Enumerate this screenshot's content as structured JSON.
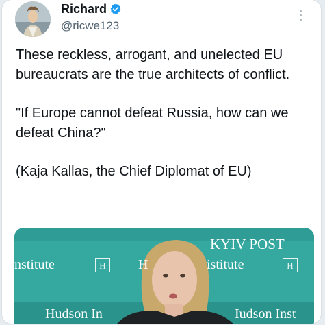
{
  "author": {
    "display_name": "Richard",
    "handle": "@ricwe123",
    "verified": true
  },
  "tweet": {
    "paragraphs": [
      "These reckless, arrogant, and unelected EU bureaucrats are the true architects of conflict.",
      "\"If Europe cannot defeat Russia, how can we defeat China?\"",
      "(Kaja Kallas, the Chief Diplomat of EU)"
    ]
  },
  "media": {
    "backdrop_texts": {
      "kyiv_post": "KYIV POST",
      "institute_left": "nstitute",
      "institute_right": "istitute",
      "hudson_left": "Hudson In",
      "hudson_right": "Iudson Inst",
      "h_logo": "H",
      "h_fragment": "H"
    }
  },
  "colors": {
    "verified_badge": "#1d9bf0",
    "backdrop_teal": "#35a8a0",
    "text_primary": "#0f1419",
    "text_secondary": "#536471"
  },
  "icons": {
    "verified": "verified-badge-icon",
    "more": "more-options-icon"
  }
}
